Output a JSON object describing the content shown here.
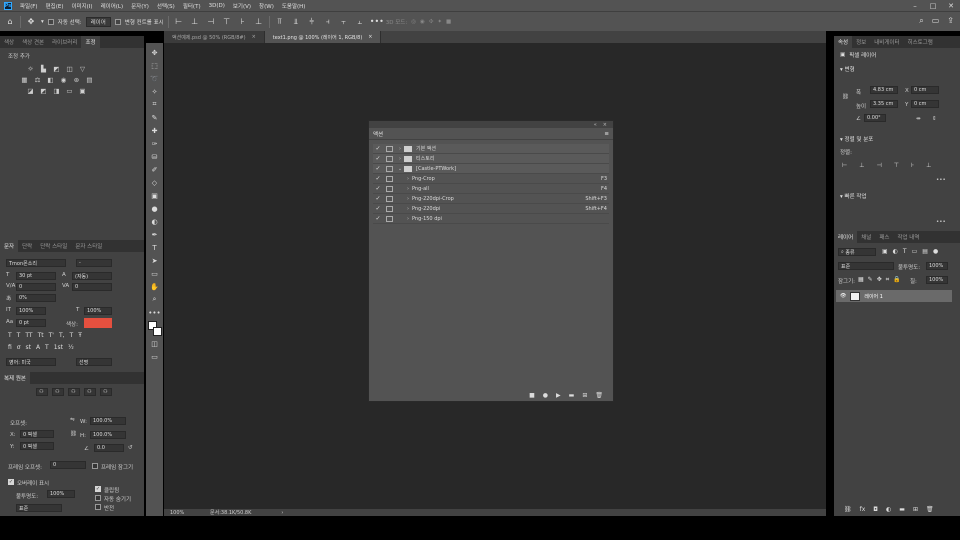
{
  "menubar": {
    "app_icon": "Ps",
    "items": [
      "파일(F)",
      "편집(E)",
      "이미지(I)",
      "레이어(L)",
      "문자(Y)",
      "선택(S)",
      "필터(T)",
      "3D(D)",
      "보기(V)",
      "창(W)",
      "도움말(H)"
    ],
    "window_controls": [
      "minimize-icon",
      "maximize-icon",
      "close-icon"
    ]
  },
  "options": {
    "auto_select_label": "자동 선택:",
    "auto_select_value": "레이어",
    "transform_controls_label": "변형 컨트롤 표시",
    "mode_3d_label": "3D 모드:"
  },
  "doc_tabs": [
    {
      "label": "액션예제.psd @ 50% (RGB/8#)",
      "active": false
    },
    {
      "label": "text1.png @ 100% (레이어 1, RGB/8)",
      "active": true
    }
  ],
  "left_panel": {
    "top_tabs": [
      "색상",
      "색상 견본",
      "라이브러리",
      "조정"
    ],
    "adjust_title": "조정 추가",
    "char_tabs": [
      "문자",
      "단락",
      "단락 스타일",
      "문자 스타일"
    ],
    "font_family": "Tmon몬소리",
    "font_style": "-",
    "font_size": "30 pt",
    "leading": "(자동)",
    "kerning": "0",
    "tracking": "0",
    "tsume": "0%",
    "vscale": "100%",
    "hscale": "100%",
    "baseline": "0 pt",
    "color_label": "색상:",
    "color": "#e5503f",
    "language": "영어: 미국",
    "aa": "선명",
    "clone_title": "복제 원본",
    "offset_label": "오프셋:",
    "x_label": "X:",
    "x_val": "0 픽셀",
    "y_label": "Y:",
    "y_val": "0 픽셀",
    "w_label": "W:",
    "w_val": "100.0%",
    "h_label": "H:",
    "h_val": "100.0%",
    "angle_val": "0.0",
    "frame_offset_label": "프레임 오프셋:",
    "frame_offset_val": "0",
    "frame_lock_label": "프레임 잠그기",
    "overlay_label": "오버레이 표시",
    "opacity_label": "불투명도:",
    "opacity_val": "100%",
    "mode_val": "표준",
    "clipped_label": "클립됨",
    "auto_hide_label": "자동 숨기기",
    "invert_label": "반전"
  },
  "actions_panel": {
    "title": "액션",
    "rows": [
      {
        "indent": 0,
        "expanded": false,
        "folder": true,
        "name": "기본 액션",
        "key": ""
      },
      {
        "indent": 0,
        "expanded": false,
        "folder": true,
        "name": "티스토리",
        "key": ""
      },
      {
        "indent": 0,
        "expanded": true,
        "folder": true,
        "name": "[Castle-PTWork]",
        "key": ""
      },
      {
        "indent": 1,
        "expanded": false,
        "folder": false,
        "name": "Png-Crop",
        "key": "F3"
      },
      {
        "indent": 1,
        "expanded": false,
        "folder": false,
        "name": "Png-all",
        "key": "F4"
      },
      {
        "indent": 1,
        "expanded": false,
        "folder": false,
        "name": "Png-220dpi-Crop",
        "key": "Shift+F3"
      },
      {
        "indent": 1,
        "expanded": false,
        "folder": false,
        "name": "Png-220dpi",
        "key": "Shift+F4"
      },
      {
        "indent": 1,
        "expanded": false,
        "folder": false,
        "name": "Png-150 dpi",
        "key": ""
      }
    ]
  },
  "status": {
    "zoom": "100%",
    "doc": "문서:38.1K/50.8K"
  },
  "right_panel": {
    "tabs": [
      "속성",
      "정보",
      "내비게이터",
      "히스토그램"
    ],
    "pixel_layer": "픽셀 레이어",
    "transform_title": "변형",
    "w_label": "폭",
    "w_val": "4.83 cm",
    "h_label": "높이",
    "h_val": "3.35 cm",
    "x_label": "X",
    "x_val": "0 cm",
    "y_label": "Y",
    "y_val": "0 cm",
    "angle_val": "0.00°",
    "align_title": "정렬 및 분포",
    "align_label": "정렬:",
    "quick_title": "빠른 작업",
    "layers_tabs": [
      "레이어",
      "채널",
      "패스",
      "작업 내역"
    ],
    "filter_kind": "종류",
    "blend_mode": "표준",
    "opacity_label": "불투명도:",
    "opacity_val": "100%",
    "lock_label": "잠그기:",
    "fill_label": "칠:",
    "fill_val": "100%",
    "layer_name": "레이어 1"
  }
}
